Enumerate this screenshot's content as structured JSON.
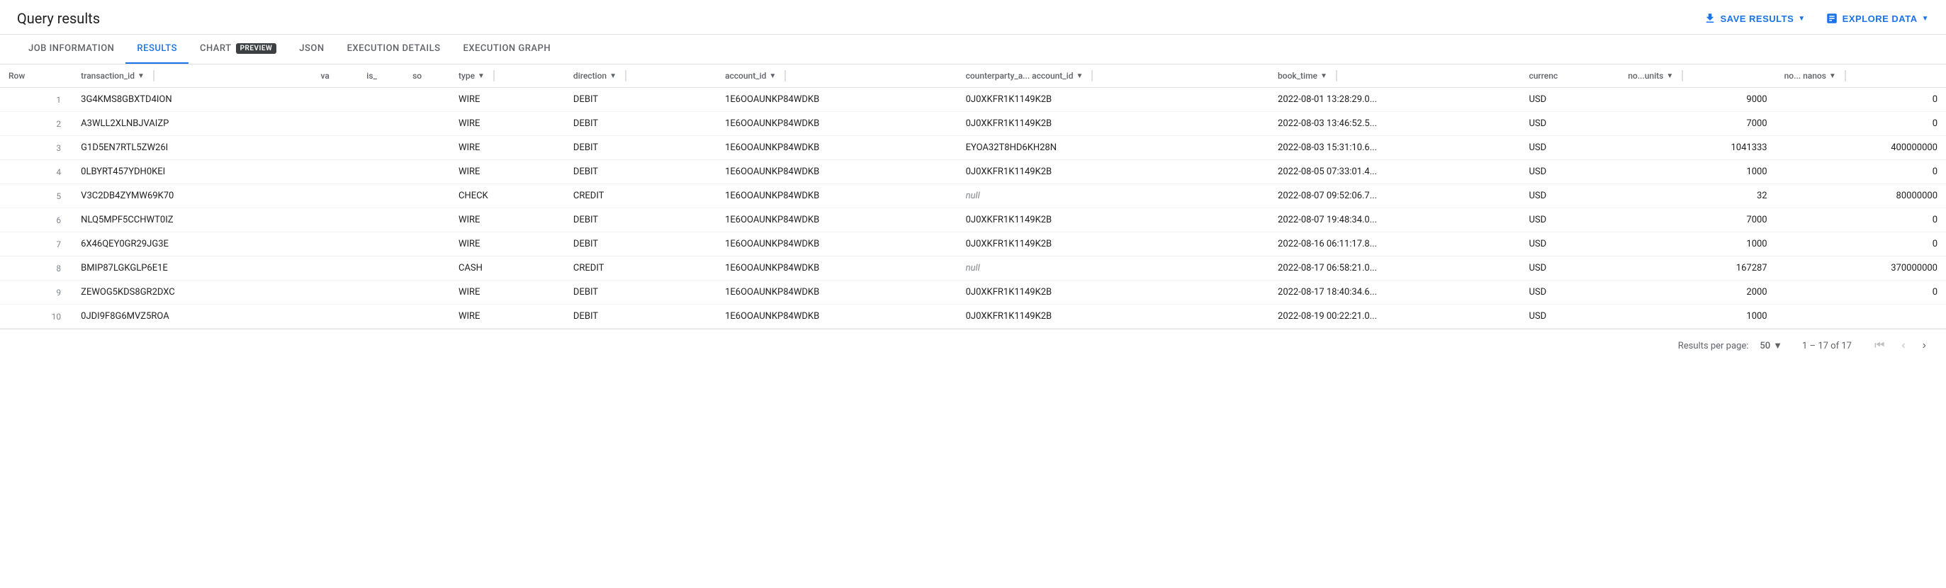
{
  "header": {
    "title": "Query results",
    "save_results_label": "SAVE RESULTS",
    "explore_data_label": "EXPLORE DATA"
  },
  "tabs": [
    {
      "id": "job-information",
      "label": "JOB INFORMATION",
      "active": false
    },
    {
      "id": "results",
      "label": "RESULTS",
      "active": true
    },
    {
      "id": "chart",
      "label": "CHART",
      "active": false,
      "has_preview": true
    },
    {
      "id": "json",
      "label": "JSON",
      "active": false
    },
    {
      "id": "execution-details",
      "label": "EXECUTION DETAILS",
      "active": false
    },
    {
      "id": "execution-graph",
      "label": "EXECUTION GRAPH",
      "active": false
    }
  ],
  "table": {
    "columns": [
      {
        "id": "row",
        "label": "Row",
        "sortable": false
      },
      {
        "id": "transaction_id",
        "label": "transaction_id",
        "sortable": true
      },
      {
        "id": "va",
        "label": "va",
        "sortable": false
      },
      {
        "id": "is_",
        "label": "is_",
        "sortable": false
      },
      {
        "id": "so",
        "label": "so",
        "sortable": false
      },
      {
        "id": "type",
        "label": "type",
        "sortable": true
      },
      {
        "id": "direction",
        "label": "direction",
        "sortable": true
      },
      {
        "id": "account_id",
        "label": "account_id",
        "sortable": true
      },
      {
        "id": "counterparty_a_account_id",
        "label": "counterparty_a... account_id",
        "sortable": true
      },
      {
        "id": "book_time",
        "label": "book_time",
        "sortable": true
      },
      {
        "id": "currency",
        "label": "currenc",
        "sortable": false
      },
      {
        "id": "no_units",
        "label": "no...units",
        "sortable": true
      },
      {
        "id": "no_nanos",
        "label": "no... nanos",
        "sortable": true
      }
    ],
    "rows": [
      {
        "row": 1,
        "transaction_id": "3G4KMS8GBXTD4ION",
        "va": "",
        "is_": "",
        "so": "",
        "type": "WIRE",
        "direction": "DEBIT",
        "account_id": "1E6OOAUNKP84WDKB",
        "counterparty_account_id": "0J0XKFR1K1149K2B",
        "book_time": "2022-08-01 13:28:29.0...",
        "currency": "USD",
        "no_units": "9000",
        "no_nanos": "0"
      },
      {
        "row": 2,
        "transaction_id": "A3WLL2XLNBJVAIZP",
        "va": "",
        "is_": "",
        "so": "",
        "type": "WIRE",
        "direction": "DEBIT",
        "account_id": "1E6OOAUNKP84WDKB",
        "counterparty_account_id": "0J0XKFR1K1149K2B",
        "book_time": "2022-08-03 13:46:52.5...",
        "currency": "USD",
        "no_units": "7000",
        "no_nanos": "0"
      },
      {
        "row": 3,
        "transaction_id": "G1D5EN7RTL5ZW26I",
        "va": "",
        "is_": "",
        "so": "",
        "type": "WIRE",
        "direction": "DEBIT",
        "account_id": "1E6OOAUNKP84WDKB",
        "counterparty_account_id": "EYOA32T8HD6KH28N",
        "book_time": "2022-08-03 15:31:10.6...",
        "currency": "USD",
        "no_units": "1041333",
        "no_nanos": "400000000"
      },
      {
        "row": 4,
        "transaction_id": "0LBYRT457YDH0KEI",
        "va": "",
        "is_": "",
        "so": "",
        "type": "WIRE",
        "direction": "DEBIT",
        "account_id": "1E6OOAUNKP84WDKB",
        "counterparty_account_id": "0J0XKFR1K1149K2B",
        "book_time": "2022-08-05 07:33:01.4...",
        "currency": "USD",
        "no_units": "1000",
        "no_nanos": "0"
      },
      {
        "row": 5,
        "transaction_id": "V3C2DB4ZYMW69K70",
        "va": "",
        "is_": "",
        "so": "",
        "type": "CHECK",
        "direction": "CREDIT",
        "account_id": "1E6OOAUNKP84WDKB",
        "counterparty_account_id": "null",
        "book_time": "2022-08-07 09:52:06.7...",
        "currency": "USD",
        "no_units": "32",
        "no_nanos": "80000000"
      },
      {
        "row": 6,
        "transaction_id": "NLQ5MPF5CCHWT0IZ",
        "va": "",
        "is_": "",
        "so": "",
        "type": "WIRE",
        "direction": "DEBIT",
        "account_id": "1E6OOAUNKP84WDKB",
        "counterparty_account_id": "0J0XKFR1K1149K2B",
        "book_time": "2022-08-07 19:48:34.0...",
        "currency": "USD",
        "no_units": "7000",
        "no_nanos": "0"
      },
      {
        "row": 7,
        "transaction_id": "6X46QEY0GR29JG3E",
        "va": "",
        "is_": "",
        "so": "",
        "type": "WIRE",
        "direction": "DEBIT",
        "account_id": "1E6OOAUNKP84WDKB",
        "counterparty_account_id": "0J0XKFR1K1149K2B",
        "book_time": "2022-08-16 06:11:17.8...",
        "currency": "USD",
        "no_units": "1000",
        "no_nanos": "0"
      },
      {
        "row": 8,
        "transaction_id": "BMIP87LGKGLP6E1E",
        "va": "",
        "is_": "",
        "so": "",
        "type": "CASH",
        "direction": "CREDIT",
        "account_id": "1E6OOAUNKP84WDKB",
        "counterparty_account_id": "null",
        "book_time": "2022-08-17 06:58:21.0...",
        "currency": "USD",
        "no_units": "167287",
        "no_nanos": "370000000"
      },
      {
        "row": 9,
        "transaction_id": "ZEWOG5KDS8GR2DXC",
        "va": "",
        "is_": "",
        "so": "",
        "type": "WIRE",
        "direction": "DEBIT",
        "account_id": "1E6OOAUNKP84WDKB",
        "counterparty_account_id": "0J0XKFR1K1149K2B",
        "book_time": "2022-08-17 18:40:34.6...",
        "currency": "USD",
        "no_units": "2000",
        "no_nanos": "0"
      },
      {
        "row": 10,
        "transaction_id": "0JDI9F8G6MVZ5ROA",
        "va": "",
        "is_": "",
        "so": "",
        "type": "WIRE",
        "direction": "DEBIT",
        "account_id": "1E6OOAUNKP84WDKB",
        "counterparty_account_id": "0J0XKFR1K1149K2B",
        "book_time": "2022-08-19 00:22:21.0...",
        "currency": "USD",
        "no_units": "1000",
        "no_nanos": ""
      }
    ]
  },
  "footer": {
    "results_per_page_label": "Results per page:",
    "per_page_value": "50",
    "range_text": "1 – 17 of 17"
  }
}
